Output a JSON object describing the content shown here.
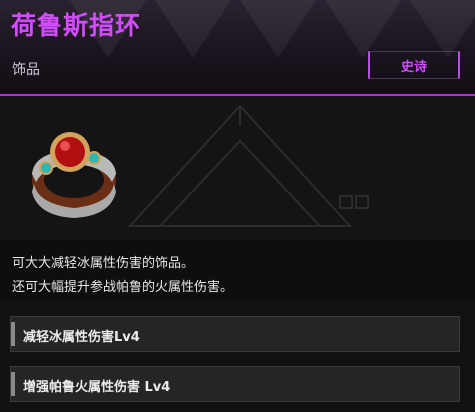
{
  "item": {
    "name": "荷鲁斯指环",
    "category": "饰品",
    "rarity": "史诗",
    "icon": "ring-icon"
  },
  "description": {
    "line1": "可大大减轻冰属性伤害的饰品。",
    "line2": "还可大幅提升参战帕鲁的火属性伤害。"
  },
  "effects": [
    {
      "label": "减轻冰属性伤害Lv4"
    },
    {
      "label": "增强帕鲁火属性伤害 Lv4"
    }
  ],
  "colors": {
    "accent": "#d24bff",
    "divider": "#b52ee0"
  }
}
